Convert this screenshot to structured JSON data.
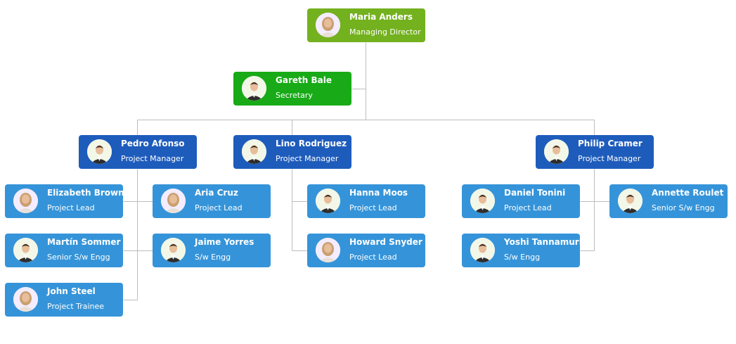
{
  "colors": {
    "director": "#73b11e",
    "secretary": "#18ab17",
    "manager": "#1e5cbc",
    "staff": "#3594d9",
    "connector": "#bdbdbd"
  },
  "org": [
    {
      "id": "maria",
      "name": "Maria Anders",
      "role": "Managing Director",
      "level": "director",
      "avatar": "female"
    },
    {
      "id": "gareth",
      "name": "Gareth Bale",
      "role": "Secretary",
      "level": "secretary",
      "avatar": "male"
    },
    {
      "id": "pedro",
      "name": "Pedro Afonso",
      "role": "Project Manager",
      "level": "manager",
      "avatar": "male"
    },
    {
      "id": "lino",
      "name": "Lino Rodriguez",
      "role": "Project Manager",
      "level": "manager",
      "avatar": "male"
    },
    {
      "id": "philip",
      "name": "Philip Cramer",
      "role": "Project Manager",
      "level": "manager",
      "avatar": "male"
    },
    {
      "id": "elizabeth",
      "name": "Elizabeth Brown",
      "role": "Project Lead",
      "level": "staff",
      "avatar": "female"
    },
    {
      "id": "aria",
      "name": "Aria Cruz",
      "role": "Project Lead",
      "level": "staff",
      "avatar": "female"
    },
    {
      "id": "martin",
      "name": "Martín Sommer",
      "role": "Senior S/w Engg",
      "level": "staff",
      "avatar": "male"
    },
    {
      "id": "jaime",
      "name": "Jaime Yorres",
      "role": "S/w Engg",
      "level": "staff",
      "avatar": "male"
    },
    {
      "id": "john",
      "name": "John Steel",
      "role": "Project Trainee",
      "level": "staff",
      "avatar": "female"
    },
    {
      "id": "hanna",
      "name": "Hanna Moos",
      "role": "Project Lead",
      "level": "staff",
      "avatar": "male"
    },
    {
      "id": "howard",
      "name": "Howard Snyder",
      "role": "Project Lead",
      "level": "staff",
      "avatar": "female"
    },
    {
      "id": "daniel",
      "name": "Daniel Tonini",
      "role": "Project Lead",
      "level": "staff",
      "avatar": "male"
    },
    {
      "id": "annette",
      "name": "Annette Roulet",
      "role": "Senior S/w Engg",
      "level": "staff",
      "avatar": "male"
    },
    {
      "id": "yoshi",
      "name": "Yoshi Tannamuri",
      "role": "S/w Engg",
      "level": "staff",
      "avatar": "male"
    }
  ]
}
